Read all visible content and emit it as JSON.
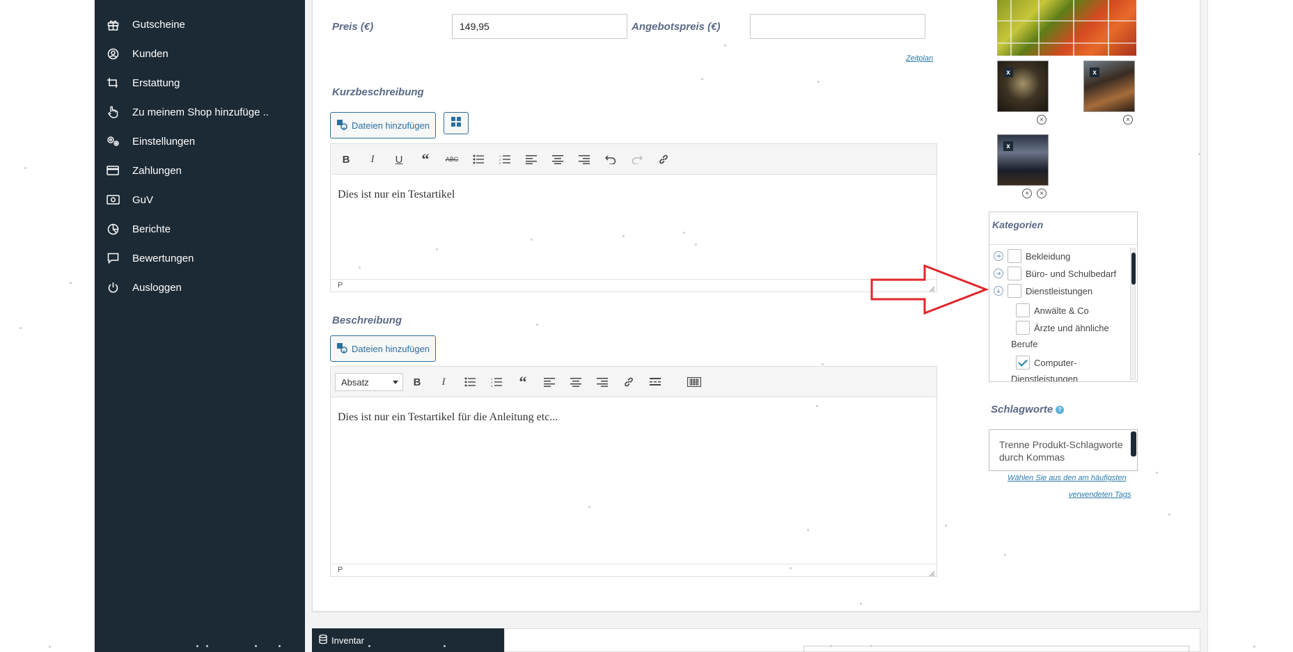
{
  "sidebar": {
    "items": [
      {
        "label": "Gutscheine",
        "icon": "gift-icon"
      },
      {
        "label": "Kunden",
        "icon": "user-circle-icon"
      },
      {
        "label": "Erstattung",
        "icon": "refund-icon"
      },
      {
        "label": "Zu meinem Shop hinzufüge ..",
        "icon": "hand-pointer-icon"
      },
      {
        "label": "Einstellungen",
        "icon": "gears-icon"
      },
      {
        "label": "Zahlungen",
        "icon": "credit-card-icon"
      },
      {
        "label": "GuV",
        "icon": "money-icon"
      },
      {
        "label": "Berichte",
        "icon": "pie-chart-icon"
      },
      {
        "label": "Bewertungen",
        "icon": "comment-icon"
      },
      {
        "label": "Ausloggen",
        "icon": "power-icon"
      }
    ]
  },
  "pricing": {
    "price_label": "Preis (€)",
    "price_value": "149,95",
    "sale_label": "Angebotspreis (€)",
    "sale_value": "",
    "schedule_link": "Zeitplan"
  },
  "short_description": {
    "label": "Kurzbeschreibung",
    "add_media": "Dateien hinzufügen",
    "content": "Dies ist nur ein Testartikel",
    "status_path": "P"
  },
  "description": {
    "label": "Beschreibung",
    "add_media": "Dateien hinzufügen",
    "format_select": "Absatz",
    "content": "Dies ist nur ein Testartikel für die Anleitung etc...",
    "status_path": "P"
  },
  "gallery": {
    "remove_label": "x"
  },
  "categories": {
    "title": "Kategorien",
    "items": [
      {
        "label": "Bekleidung",
        "checked": false,
        "level": 0,
        "expander": "collapsed"
      },
      {
        "label": "Büro- und Schulbedarf",
        "checked": false,
        "level": 0,
        "expander": "collapsed"
      },
      {
        "label": "Dienstleistungen",
        "checked": false,
        "level": 0,
        "expander": "expanded"
      },
      {
        "label": "Anwälte & Co",
        "checked": false,
        "level": 1
      },
      {
        "label": "Ärzte und ähnliche",
        "label_cont": "Berufe",
        "checked": false,
        "level": 1
      },
      {
        "label": "Computer-",
        "label_cont": "Dienstleistungen",
        "checked": true,
        "level": 1
      }
    ]
  },
  "tags": {
    "title": "Schlagworte",
    "placeholder": "Trenne Produkt-Schlagworte durch Kommas",
    "choose_link_line1": "Wählen Sie aus den am häufigsten",
    "choose_link_line2": "verwendeten Tags"
  },
  "inventory": {
    "tab_label": "Inventar"
  },
  "colors": {
    "sidebar": "#1c2a35",
    "accent": "#2b6fa0",
    "label": "#5a6a86",
    "annotation_arrow": "#e0262a"
  }
}
